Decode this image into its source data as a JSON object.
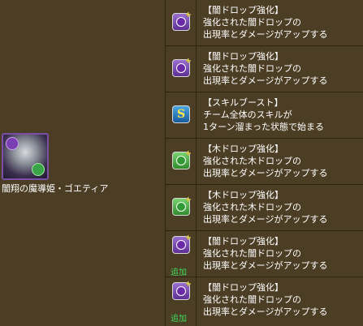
{
  "character": {
    "name": "闇翔の魔導姫・ゴエティア"
  },
  "awakenings": [
    {
      "icon": "dark-orb-enhance-icon",
      "title": "【闇ドロップ強化】",
      "line1": "強化された闇ドロップの",
      "line2": "出現率とダメージがアップする",
      "tag": ""
    },
    {
      "icon": "dark-orb-enhance-icon",
      "title": "【闇ドロップ強化】",
      "line1": "強化された闇ドロップの",
      "line2": "出現率とダメージがアップする",
      "tag": ""
    },
    {
      "icon": "skill-boost-icon",
      "title": "【スキルブースト】",
      "line1": "チーム全体のスキルが",
      "line2": "1ターン溜まった状態で始まる",
      "tag": ""
    },
    {
      "icon": "wood-orb-enhance-icon",
      "title": "【木ドロップ強化】",
      "line1": "強化された木ドロップの",
      "line2": "出現率とダメージがアップする",
      "tag": ""
    },
    {
      "icon": "wood-orb-enhance-icon",
      "title": "【木ドロップ強化】",
      "line1": "強化された木ドロップの",
      "line2": "出現率とダメージがアップする",
      "tag": ""
    },
    {
      "icon": "dark-orb-enhance-icon",
      "title": "【闇ドロップ強化】",
      "line1": "強化された闇ドロップの",
      "line2": "出現率とダメージがアップする",
      "tag": "追加"
    },
    {
      "icon": "dark-orb-enhance-icon",
      "title": "【闇ドロップ強化】",
      "line1": "強化された闇ドロップの",
      "line2": "出現率とダメージがアップする",
      "tag": "追加"
    }
  ],
  "colors": {
    "background": "#4c3e25",
    "divider": "#2e2414",
    "added_tag": "#40d85a",
    "dark": "#6a2aa8",
    "wood": "#2f9a33",
    "boost": "#1a5a9c"
  }
}
